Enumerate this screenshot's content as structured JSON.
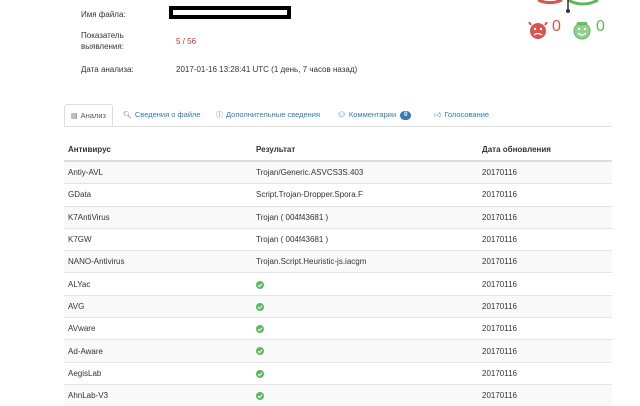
{
  "file_info": {
    "filename_label": "Имя файла:",
    "ratio_label_line1": "Показатель",
    "ratio_label_line2": "выявления:",
    "ratio_value": "5 / 56",
    "date_label": "Дата анализа:",
    "date_value": "2017-01-16 13:28:41 UTC (1 день, 7 часов назад)"
  },
  "votes": {
    "malicious_count": "0",
    "harmless_count": "0",
    "colors": {
      "malicious": "#d9534f",
      "harmless": "#5cb85c"
    }
  },
  "tabs": [
    {
      "label": "Анализ",
      "icon": "table-icon",
      "active": true
    },
    {
      "label": "Сведения о файле",
      "icon": "search-icon"
    },
    {
      "label": "Дополнительные сведения",
      "icon": "info-icon"
    },
    {
      "label": "Комментарии",
      "icon": "comment-icon",
      "badge": "0"
    },
    {
      "label": "Голосование",
      "icon": "thumbs-icon"
    }
  ],
  "table": {
    "headers": {
      "antivirus": "Антивирус",
      "result": "Результат",
      "updated": "Дата обновления"
    },
    "rows": [
      {
        "antivirus": "Antiy-AVL",
        "result": "Trojan/Generic.ASVCS3S.403",
        "detected": true,
        "updated": "20170116"
      },
      {
        "antivirus": "GData",
        "result": "Script.Trojan-Dropper.Spora.F",
        "detected": true,
        "updated": "20170116"
      },
      {
        "antivirus": "K7AntiVirus",
        "result": "Trojan ( 004f43681 )",
        "detected": true,
        "updated": "20170116"
      },
      {
        "antivirus": "K7GW",
        "result": "Trojan ( 004f43681 )",
        "detected": true,
        "updated": "20170116"
      },
      {
        "antivirus": "NANO-Antivirus",
        "result": "Trojan.Script.Heuristic-js.iacgm",
        "detected": true,
        "updated": "20170116"
      },
      {
        "antivirus": "ALYac",
        "result": "",
        "detected": false,
        "updated": "20170116"
      },
      {
        "antivirus": "AVG",
        "result": "",
        "detected": false,
        "updated": "20170116"
      },
      {
        "antivirus": "AVware",
        "result": "",
        "detected": false,
        "updated": "20170116"
      },
      {
        "antivirus": "Ad-Aware",
        "result": "",
        "detected": false,
        "updated": "20170116"
      },
      {
        "antivirus": "AegisLab",
        "result": "",
        "detected": false,
        "updated": "20170116"
      },
      {
        "antivirus": "AhnLab-V3",
        "result": "",
        "detected": false,
        "updated": "20170116"
      }
    ]
  }
}
